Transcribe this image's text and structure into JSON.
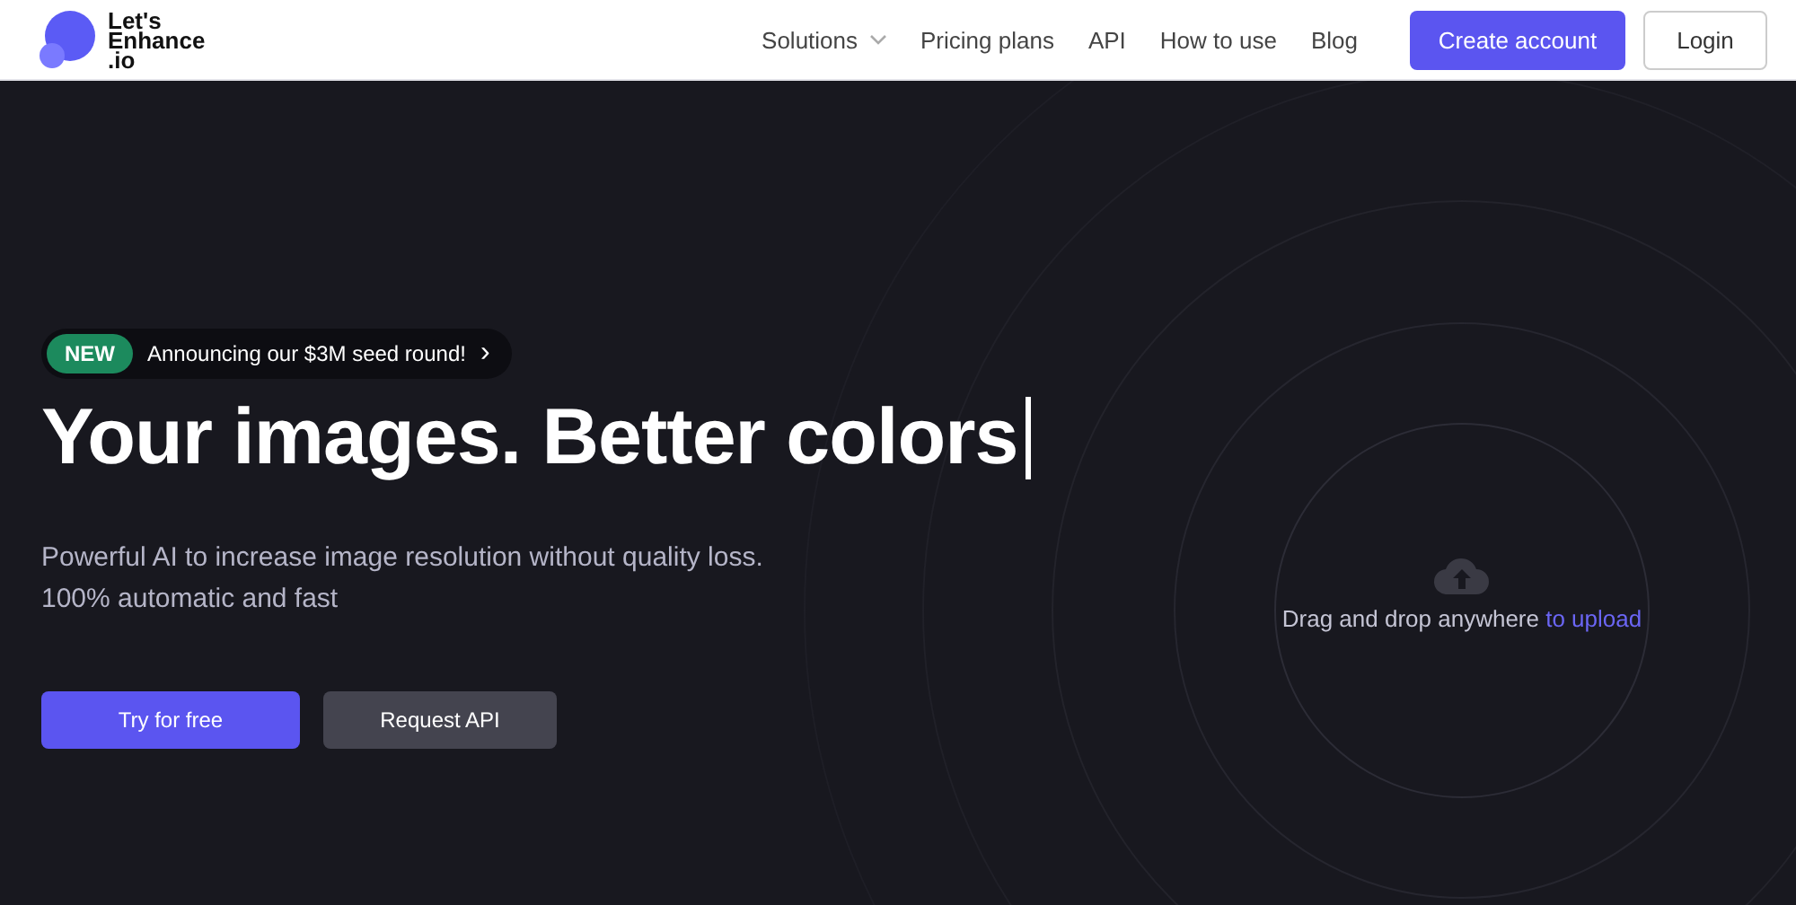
{
  "header": {
    "logo_lines": [
      "Let's",
      "Enhance",
      ".io"
    ],
    "nav": [
      {
        "label": "Solutions",
        "dropdown": true
      },
      {
        "label": "Pricing plans",
        "dropdown": false
      },
      {
        "label": "API",
        "dropdown": false
      },
      {
        "label": "How to use",
        "dropdown": false
      },
      {
        "label": "Blog",
        "dropdown": false
      }
    ],
    "create_account": "Create account",
    "login": "Login"
  },
  "hero": {
    "badge": {
      "tag": "NEW",
      "text": "Announcing our $3M seed round!",
      "chevron": "›"
    },
    "headline": "Your images. Better colors",
    "subtitle_lines": [
      "Powerful AI to increase image resolution without quality loss.",
      "100% automatic and fast"
    ],
    "primary_button": "Try for free",
    "secondary_button": "Request API"
  },
  "dropzone": {
    "text": "Drag and drop anywhere",
    "link": "to upload"
  }
}
